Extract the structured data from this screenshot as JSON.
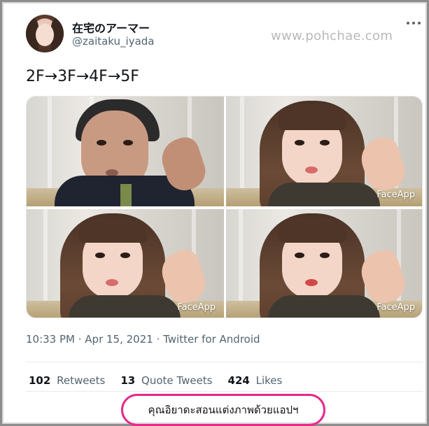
{
  "author": {
    "display_name": "在宅のアーマー",
    "handle": "@zaitaku_iyada"
  },
  "watermark": "www.pohchae.com",
  "more_icon": "more-horizontal-icon",
  "tweet": {
    "text": "2F→3F→4F→5F"
  },
  "media": {
    "photos": [
      {
        "label": ""
      },
      {
        "label": "FaceApp"
      },
      {
        "label": "FaceApp"
      },
      {
        "label": "FaceApp"
      }
    ]
  },
  "meta": {
    "timestamp": "10:33 PM · Apr 15, 2021 · Twitter for Android"
  },
  "stats": {
    "retweets": {
      "count": "102",
      "label": "Retweets"
    },
    "quote_tweets": {
      "count": "13",
      "label": "Quote Tweets"
    },
    "likes": {
      "count": "424",
      "label": "Likes"
    }
  },
  "caption": {
    "text": "คุณอิยาดะสอนแต่งภาพด้วยแอปฯ",
    "oval_color": "#e8288a"
  },
  "colors": {
    "text_primary": "#0f1419",
    "text_secondary": "#536471",
    "watermark": "#b9b9b9"
  }
}
